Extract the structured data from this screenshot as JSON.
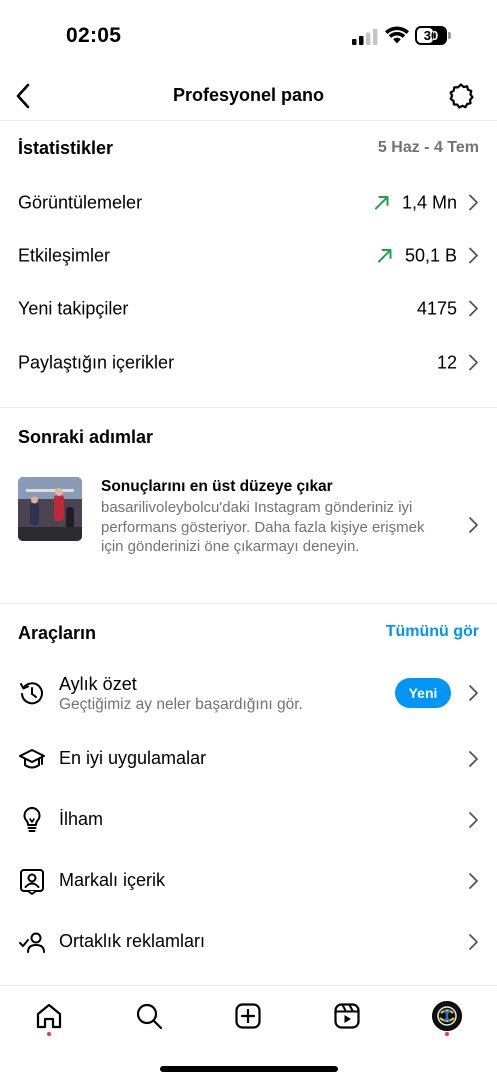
{
  "status_bar": {
    "time": "02:05",
    "battery": "30"
  },
  "header": {
    "title": "Profesyonel pano"
  },
  "stats": {
    "title": "İstatistikler",
    "date_range": "5 Haz - 4 Tem",
    "rows": [
      {
        "label": "Görüntülemeler",
        "value": "1,4 Mn",
        "trend": "up"
      },
      {
        "label": "Etkileşimler",
        "value": "50,1 B",
        "trend": "up"
      },
      {
        "label": "Yeni takipçiler",
        "value": "4175",
        "trend": ""
      },
      {
        "label": "Paylaştığın içerikler",
        "value": "12",
        "trend": ""
      }
    ]
  },
  "next_steps": {
    "title": "Sonraki adımlar",
    "card_title": "Sonuçlarını en üst düzeye çıkar",
    "card_text": "basarilivoleybolcu'daki Instagram gönderiniz iyi performans gösteriyor. Daha fazla kişiye erişmek için gönderinizi öne çıkarmayı deneyin."
  },
  "tools": {
    "title": "Araçların",
    "see_all": "Tümünü gör",
    "items": [
      {
        "label": "Aylık özet",
        "subtitle": "Geçtiğimiz ay neler başardığını gör.",
        "badge": "Yeni",
        "icon": "history-icon"
      },
      {
        "label": "En iyi uygulamalar",
        "icon": "graduation-cap-icon"
      },
      {
        "label": "İlham",
        "icon": "lightbulb-icon"
      },
      {
        "label": "Markalı içerik",
        "icon": "branded-content-icon"
      },
      {
        "label": "Ortaklık reklamları",
        "icon": "partnership-icon"
      }
    ]
  },
  "colors": {
    "accent": "#0095f6",
    "trend_up": "#1fa04a",
    "notification_dot": "#ff3040",
    "secondary_text": "#737373"
  },
  "tab_bar": {
    "icons": [
      "home-icon",
      "search-icon",
      "create-icon",
      "reels-icon",
      "profile-avatar"
    ]
  }
}
